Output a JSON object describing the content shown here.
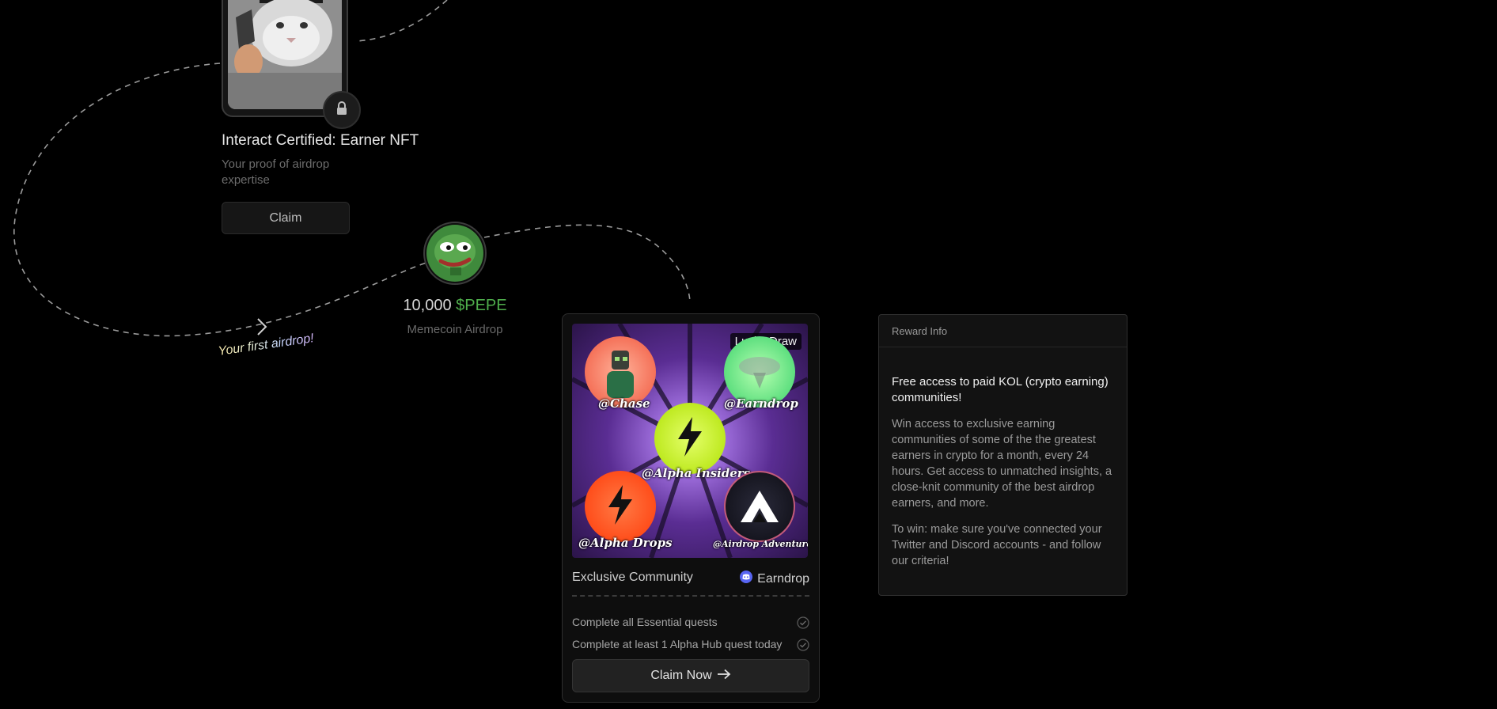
{
  "nft": {
    "title": "Interact Certified: Earner NFT",
    "subtitle": "Your proof of airdrop expertise",
    "claim_label": "Claim"
  },
  "airdrop": {
    "amount": "10,000",
    "token": "$PEPE",
    "subtitle": "Memecoin Airdrop",
    "first_airdrop": "Your first airdrop!"
  },
  "reward_card": {
    "badge": "Lucky Draw",
    "communities": [
      "@Chase",
      "@Earndrop",
      "@Alpha Insiders",
      "@Alpha Drops",
      "@Airdrop Adventure"
    ],
    "type_label": "Exclusive Community",
    "server_name": "Earndrop",
    "requirements": [
      "Complete all Essential quests",
      "Complete at least 1 Alpha Hub quest today"
    ],
    "claim_label": "Claim Now"
  },
  "reward_info": {
    "header": "Reward Info",
    "title": "Free access to paid KOL (crypto earning) communities!",
    "body1": "Win access to exclusive earning communities of some of the the greatest earners in crypto for a month, every 24 hours. Get access to unmatched insights, a close-knit community of the best airdrop earners, and more.",
    "body2": "To win: make sure you've connected your Twitter and Discord accounts - and follow our criteria!"
  },
  "colors": {
    "background": "#000000",
    "token_green": "#4fae4c",
    "discord": "#5865f2",
    "alpha_lime": "#c6f21a",
    "alpha_orange": "#ff4d12"
  },
  "icons": [
    "lock-icon",
    "arrow-right-icon",
    "discord-icon",
    "check-icon",
    "lightning-icon",
    "chevron-right-icon"
  ]
}
